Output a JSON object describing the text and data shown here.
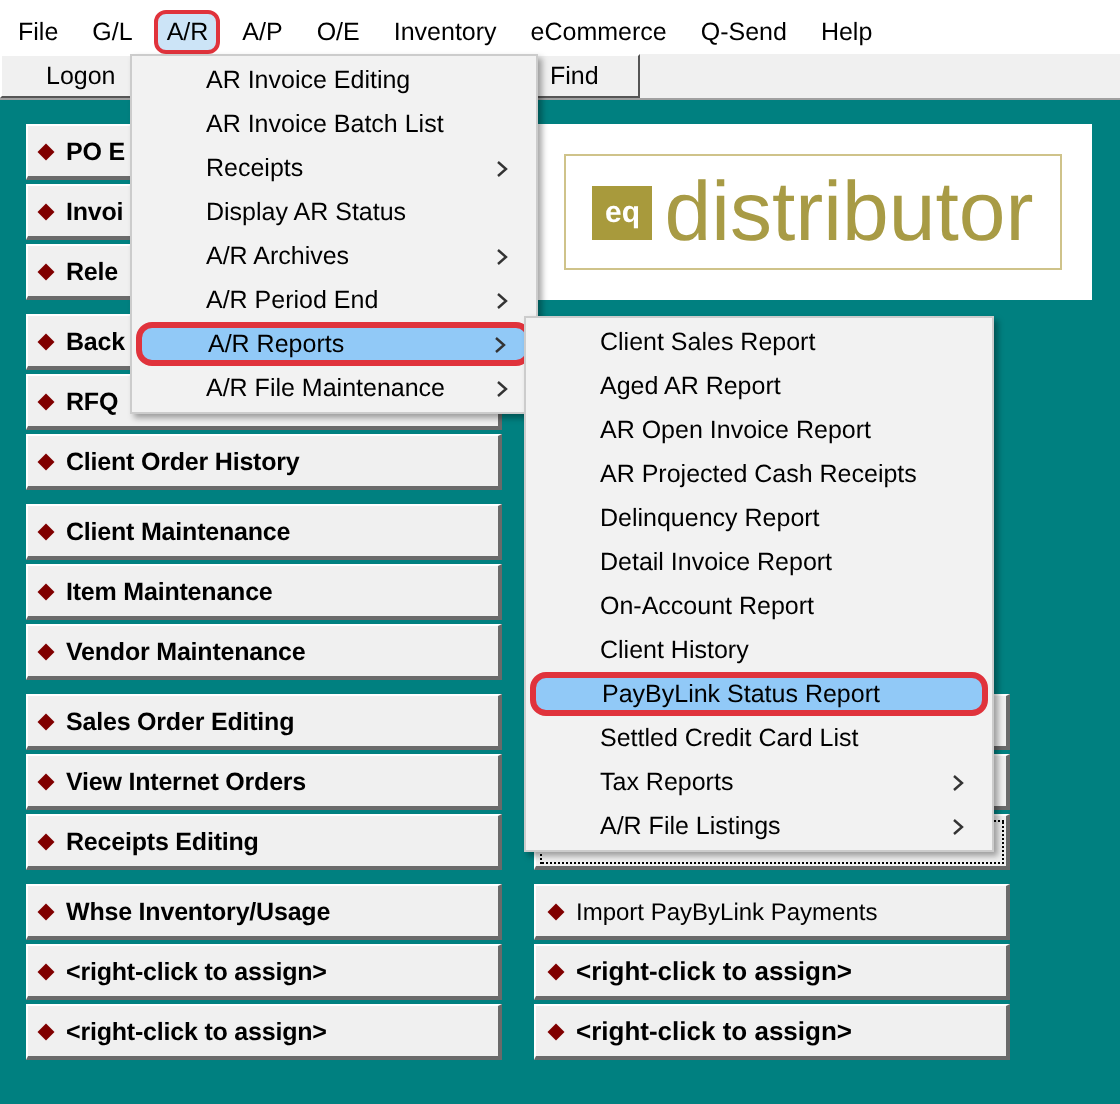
{
  "menu_bar": [
    {
      "label": "File",
      "selected": false
    },
    {
      "label": "G/L",
      "selected": false
    },
    {
      "label": "A/R",
      "selected": true
    },
    {
      "label": "A/P",
      "selected": false
    },
    {
      "label": "O/E",
      "selected": false
    },
    {
      "label": "Inventory",
      "selected": false
    },
    {
      "label": "eCommerce",
      "selected": false
    },
    {
      "label": "Q-Send",
      "selected": false
    },
    {
      "label": "Help",
      "selected": false
    }
  ],
  "toolbar": [
    {
      "label": "Logon"
    },
    {
      "label": "Find"
    }
  ],
  "logo": {
    "mark": "eq",
    "name": "distributor"
  },
  "left_groups": [
    [
      {
        "label": "PO E"
      },
      {
        "label": "Invoi"
      },
      {
        "label": "Rele"
      }
    ],
    [
      {
        "label": "Back"
      },
      {
        "label": "RFQ"
      },
      {
        "label": "Client Order History"
      }
    ],
    [
      {
        "label": "Client Maintenance"
      },
      {
        "label": "Item Maintenance"
      },
      {
        "label": "Vendor Maintenance"
      }
    ],
    [
      {
        "label": "Sales Order Editing"
      },
      {
        "label": "View Internet Orders"
      },
      {
        "label": "Receipts Editing"
      }
    ],
    [
      {
        "label": "Whse Inventory/Usage"
      },
      {
        "label": "<right-click to assign>"
      },
      {
        "label": "<right-click to assign>"
      }
    ]
  ],
  "right_covered_buttons": [
    {
      "focused": false
    },
    {
      "focused": false
    },
    {
      "focused": true
    }
  ],
  "right_bottom_buttons": [
    {
      "label": "Import PayByLink Payments",
      "bold": false
    },
    {
      "label": "<right-click to assign>",
      "bold": true
    },
    {
      "label": "<right-click to assign>",
      "bold": true
    }
  ],
  "ar_menu": [
    {
      "label": "AR Invoice Editing",
      "submenu": false,
      "selected": false
    },
    {
      "label": "AR Invoice Batch List",
      "submenu": false,
      "selected": false
    },
    {
      "label": "Receipts",
      "submenu": true,
      "selected": false
    },
    {
      "label": "Display AR Status",
      "submenu": false,
      "selected": false
    },
    {
      "label": "A/R Archives",
      "submenu": true,
      "selected": false
    },
    {
      "label": "A/R Period End",
      "submenu": true,
      "selected": false
    },
    {
      "label": "A/R Reports",
      "submenu": true,
      "selected": true
    },
    {
      "label": "A/R File Maintenance",
      "submenu": true,
      "selected": false
    }
  ],
  "reports_submenu": [
    {
      "label": "Client Sales Report",
      "submenu": false,
      "selected": false
    },
    {
      "label": "Aged AR Report",
      "submenu": false,
      "selected": false
    },
    {
      "label": "AR Open Invoice Report",
      "submenu": false,
      "selected": false
    },
    {
      "label": "AR Projected Cash Receipts",
      "submenu": false,
      "selected": false
    },
    {
      "label": "Delinquency Report",
      "submenu": false,
      "selected": false
    },
    {
      "label": "Detail Invoice Report",
      "submenu": false,
      "selected": false
    },
    {
      "label": "On-Account Report",
      "submenu": false,
      "selected": false
    },
    {
      "label": "Client History",
      "submenu": false,
      "selected": false
    },
    {
      "label": "PayByLink Status Report",
      "submenu": false,
      "selected": true
    },
    {
      "label": "Settled Credit Card List",
      "submenu": false,
      "selected": false
    },
    {
      "label": "Tax Reports",
      "submenu": true,
      "selected": false
    },
    {
      "label": "A/R File Listings",
      "submenu": true,
      "selected": false
    }
  ]
}
